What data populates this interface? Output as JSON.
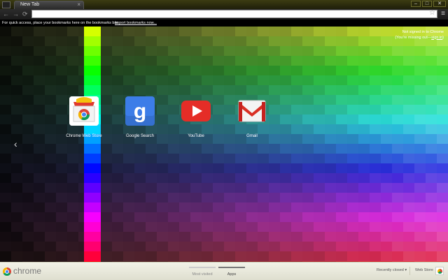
{
  "tab": {
    "title": "New Tab",
    "close": "×"
  },
  "window": {
    "minimize": "–",
    "maximize": "□",
    "close": "✕"
  },
  "toolbar": {
    "back": "←",
    "forward": "→",
    "reload": "⟳",
    "omnibox_value": "",
    "star": "☆",
    "menu": "≡"
  },
  "bookmark_bar": {
    "message": "For quick access, place your bookmarks here on the bookmarks bar.",
    "import_link": "Import bookmarks now..."
  },
  "signin": {
    "line1": "Not signed in to Chrome",
    "line2_prefix": "(You're missing out—",
    "line2_link": "sign in",
    "line2_suffix": ")"
  },
  "nav": {
    "prev": "‹"
  },
  "apps": [
    {
      "label": "Chrome Web Store",
      "icon": "chrome-web-store-icon"
    },
    {
      "label": "Google Search",
      "icon": "google-search-icon"
    },
    {
      "label": "YouTube",
      "icon": "youtube-icon"
    },
    {
      "label": "Gmail",
      "icon": "gmail-icon"
    }
  ],
  "footer": {
    "brand": "chrome",
    "tabs": [
      {
        "label": "Most visited",
        "active": false
      },
      {
        "label": "Apps",
        "active": true
      }
    ],
    "recently_closed": "Recently closed ▾",
    "web_store": "Web Store"
  }
}
